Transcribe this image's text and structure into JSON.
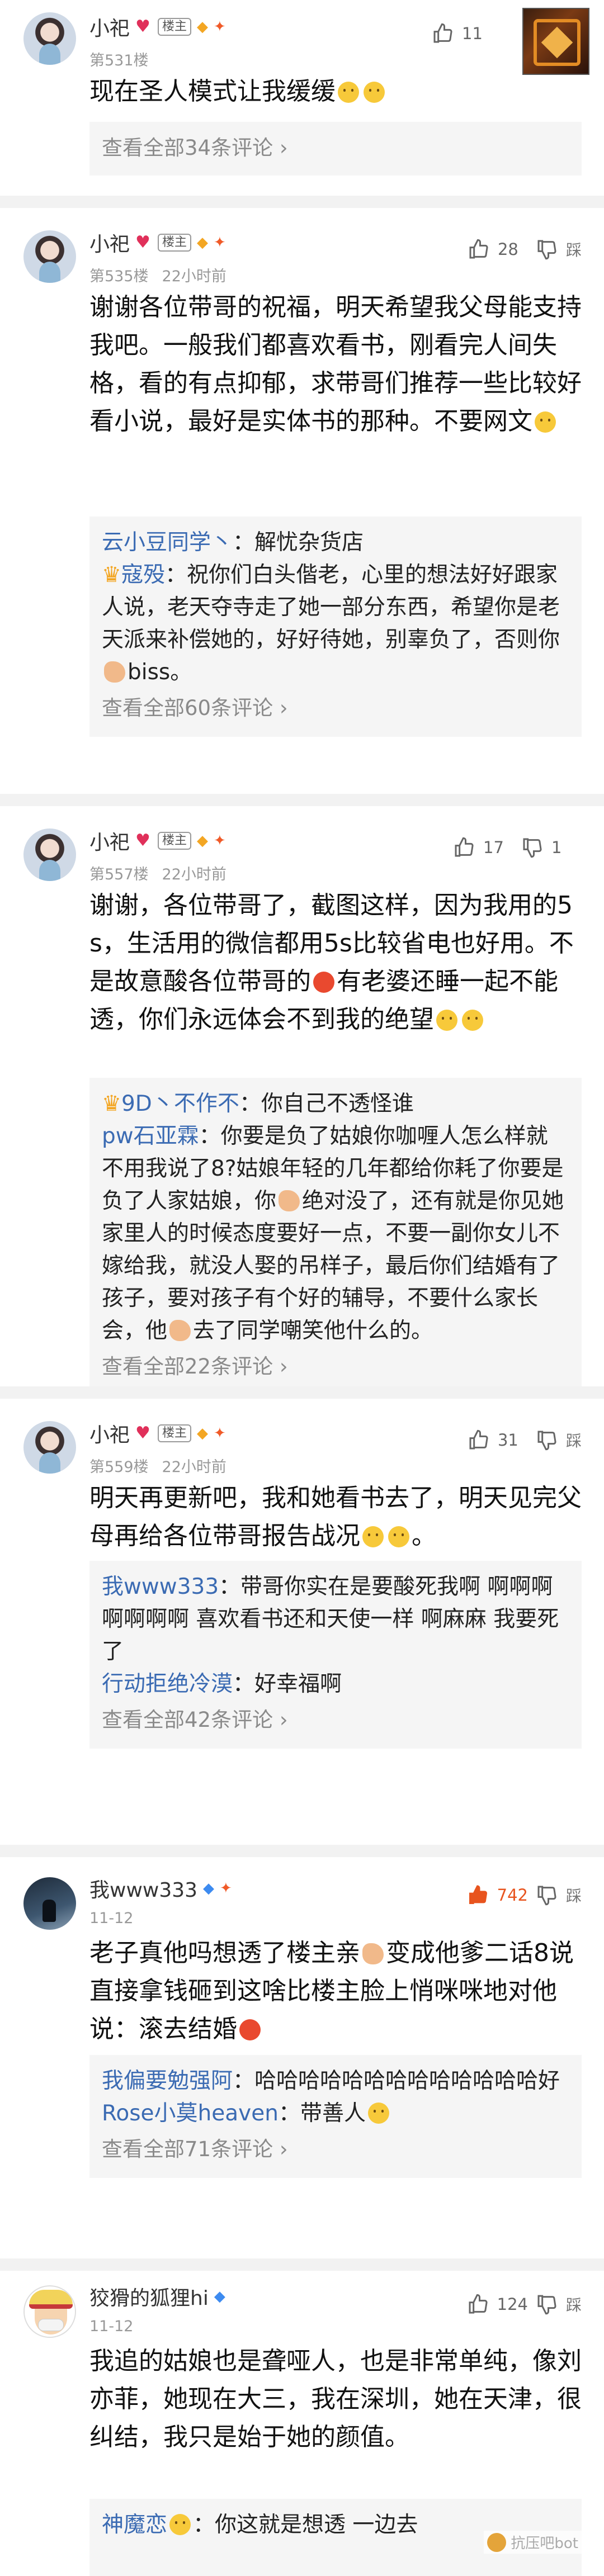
{
  "comments": [
    {
      "name": "小祀",
      "badge": "楼主",
      "floor": "第531楼",
      "time": "",
      "likes": "11",
      "text": "现在圣人模式让我缓缓",
      "view_all": "查看全部34条评论"
    },
    {
      "name": "小祀",
      "badge": "楼主",
      "floor": "第535楼",
      "time": "22小时前",
      "likes": "28",
      "step_label": "踩",
      "text": "谢谢各位带哥的祝福，明天希望我父母能支持我吧。一般我们都喜欢看书，刚看完人间失格，看的有点抑郁，求带哥们推荐一些比较好看小说，最好是实体书的那种。不要网文",
      "replies": [
        {
          "user": "云小豆同学丶",
          "text": "解忧杂货店"
        },
        {
          "user": "寇殁",
          "text": "祝你们白头偕老，心里的想法好好跟家人说，老天夺寺走了她一部分东西，希望你是老天派来补偿她的，好好待她，别辜负了，否则你",
          "suffix": "biss。"
        }
      ],
      "view_all": "查看全部60条评论"
    },
    {
      "name": "小祀",
      "badge": "楼主",
      "floor": "第557楼",
      "time": "22小时前",
      "likes": "17",
      "dislikes": "1",
      "text_a": "谢谢，各位带哥了，截图这样，因为我用的5s，生活用的微信都用5s比较省电也好用。不是故意酸各位带哥的",
      "text_b": "有老婆还睡一起不能透，你们永远体会不到我的绝望",
      "replies": [
        {
          "user": "9D丶不作不",
          "text": "你自己不透怪谁"
        },
        {
          "user": "pw石亚霖",
          "text": "你要是负了姑娘你咖喱人怎么样就不用我说了8?姑娘年轻的几年都给你耗了你要是负了人家姑娘，你",
          "mid": "绝对没了，还有就是你见她家里人的时候态度要好一点，不要一副你女儿不嫁给我，就没人娶的吊样子，最后你们结婚有了孩子，要对孩子有个好的辅导，不要什么家长会，他",
          "suffix": "去了同学嘲笑他什么的。"
        }
      ],
      "view_all": "查看全部22条评论"
    },
    {
      "name": "小祀",
      "badge": "楼主",
      "floor": "第559楼",
      "time": "22小时前",
      "likes": "31",
      "step_label": "踩",
      "text": "明天再更新吧，我和她看书去了，明天见完父母再给各位带哥报告战况",
      "text_end": "。",
      "replies": [
        {
          "user": "我www333",
          "text": "带哥你实在是要酸死我啊 啊啊啊啊啊啊啊 喜欢看书还和天使一样 啊麻麻 我要死了"
        },
        {
          "user": "行动拒绝冷漠",
          "text": "好幸福啊"
        }
      ],
      "view_all": "查看全部42条评论"
    },
    {
      "name": "我www333",
      "floor": "11-12",
      "likes": "742",
      "step_label": "踩",
      "text_a": "老子真他吗想透了楼主亲",
      "text_b": "变成他爹二话8说直接拿钱砸到这啥比楼主脸上悄咪咪地对他说：滚去结婚",
      "replies": [
        {
          "user": "我偏要勉强阿",
          "text": "哈哈哈哈哈哈哈哈哈哈哈哈哈好"
        },
        {
          "user": "Rose小莫heaven",
          "text": "带善人"
        }
      ],
      "view_all": "查看全部71条评论"
    },
    {
      "name": "狡猾的狐狸hi",
      "floor": "11-12",
      "likes": "124",
      "step_label": "踩",
      "text": "我追的姑娘也是聋哑人，也是非常单纯，像刘亦菲，她现在大三，我在深圳，她在天津，很纠结，我只是始于她的颜值。",
      "replies": [
        {
          "user": "神魔恋",
          "text": "你这就是想透 一边去"
        }
      ]
    }
  ],
  "watermark": "抗压吧bot",
  "colors": {
    "link": "#3b6bb3",
    "hot": "#e8541e",
    "muted": "#999999"
  }
}
